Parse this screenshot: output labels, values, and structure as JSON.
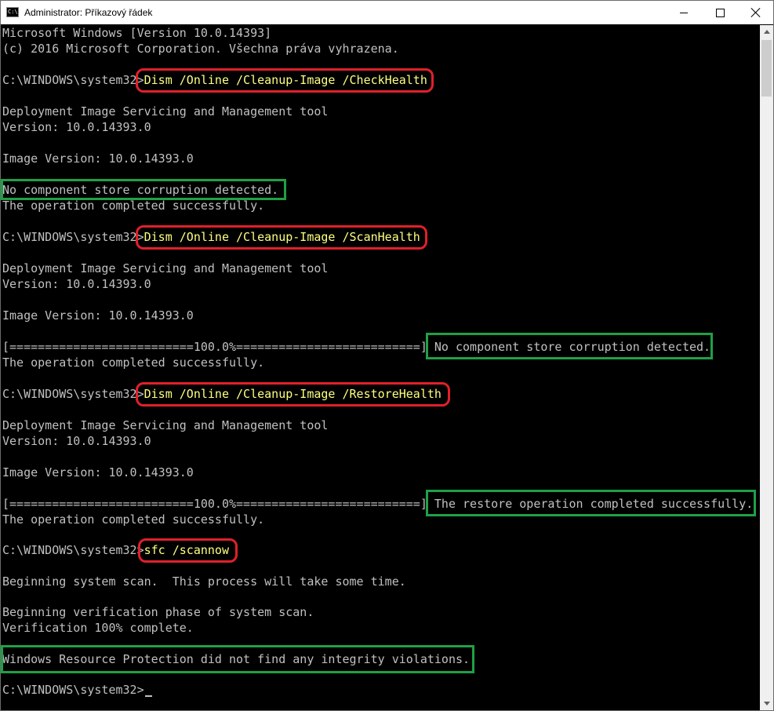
{
  "window": {
    "title": "Administrator: Příkazový řádek",
    "icon_text": "C:\\"
  },
  "console": {
    "header": [
      "Microsoft Windows [Version 10.0.14393]",
      "(c) 2016 Microsoft Corporation. Všechna práva vyhrazena."
    ],
    "prompt": "C:\\WINDOWS\\system32>",
    "commands": [
      "Dism /Online /Cleanup-Image /CheckHealth",
      "Dism /Online /Cleanup-Image /ScanHealth",
      "Dism /Online /Cleanup-Image /RestoreHealth",
      "sfc /scannow"
    ],
    "dism_tool_name": "Deployment Image Servicing and Management tool",
    "dism_version": "Version: 10.0.14393.0",
    "image_version": "Image Version: 10.0.14393.0",
    "no_corruption": "No component store corruption detected.",
    "op_success": "The operation completed successfully.",
    "progress_bar": "[==========================100.0%==========================]",
    "restore_success": "The restore operation completed successfully.",
    "sfc_begin": "Beginning system scan.  This process will take some time.",
    "sfc_verify_phase": "Beginning verification phase of system scan.",
    "sfc_verify_complete": "Verification 100% complete.",
    "wrp_result": "Windows Resource Protection did not find any integrity violations."
  },
  "colors": {
    "background": "#000000",
    "text": "#c0c0c0",
    "command_text": "#ffff80",
    "highlight_command": "#e0202a",
    "highlight_result": "#1fa045"
  }
}
